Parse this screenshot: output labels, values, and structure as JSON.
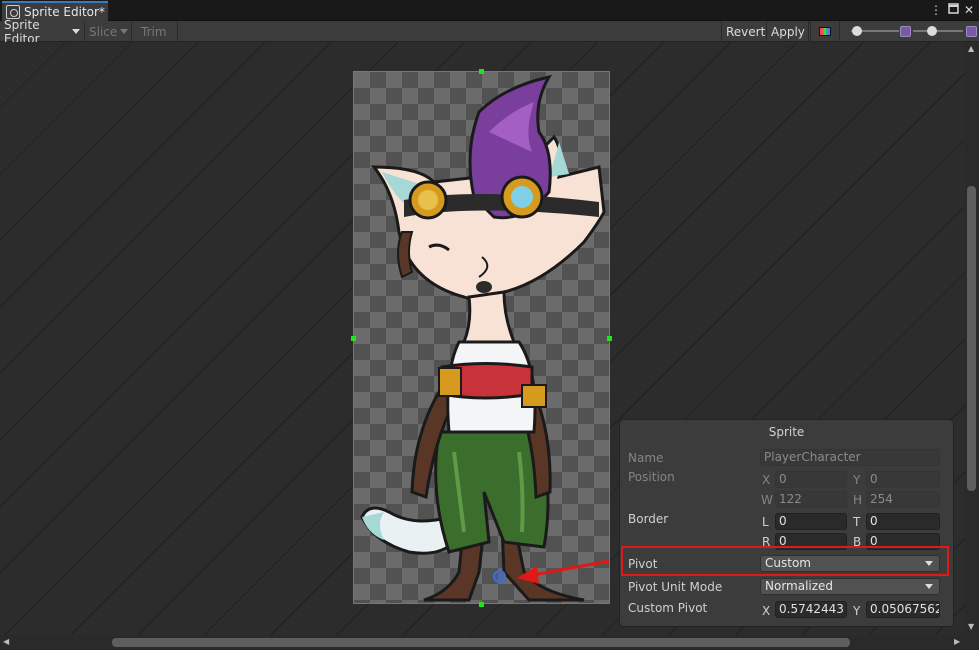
{
  "window": {
    "tab_title": "Sprite Editor*",
    "menu_icon": "more-vertical-icon",
    "maximize_icon": "maximize-icon",
    "close_icon": "close-icon"
  },
  "toolbar": {
    "mode_label": "Sprite Editor",
    "slice_label": "Slice",
    "trim_label": "Trim",
    "revert_label": "Revert",
    "apply_label": "Apply",
    "channel_icon": "rgb-channels-icon",
    "zoom_slider_value": 0.1,
    "mip_slider_value": 0.3
  },
  "canvas": {
    "sprite_asset": "fox-character-sprite"
  },
  "panel": {
    "title": "Sprite",
    "name_label": "Name",
    "name_value": "PlayerCharacter",
    "position_label": "Position",
    "x_label": "X",
    "x_value": "0",
    "y_label": "Y",
    "y_value": "0",
    "w_label": "W",
    "w_value": "122",
    "h_label": "H",
    "h_value": "254",
    "border_label": "Border",
    "l_label": "L",
    "l_value": "0",
    "t_label": "T",
    "t_value": "0",
    "r_label": "R",
    "r_value": "0",
    "b_label": "B",
    "b_value": "0",
    "pivot_label": "Pivot",
    "pivot_value": "Custom",
    "pivot_unit_label": "Pivot Unit Mode",
    "pivot_unit_value": "Normalized",
    "custom_pivot_label": "Custom Pivot",
    "custom_pivot_x_label": "X",
    "custom_pivot_x": "0.5742443",
    "custom_pivot_y_label": "Y",
    "custom_pivot_y": "0.05067562"
  },
  "colors": {
    "highlight": "#e01818",
    "accent": "#3a79bb",
    "selection_handle": "#22e022"
  }
}
